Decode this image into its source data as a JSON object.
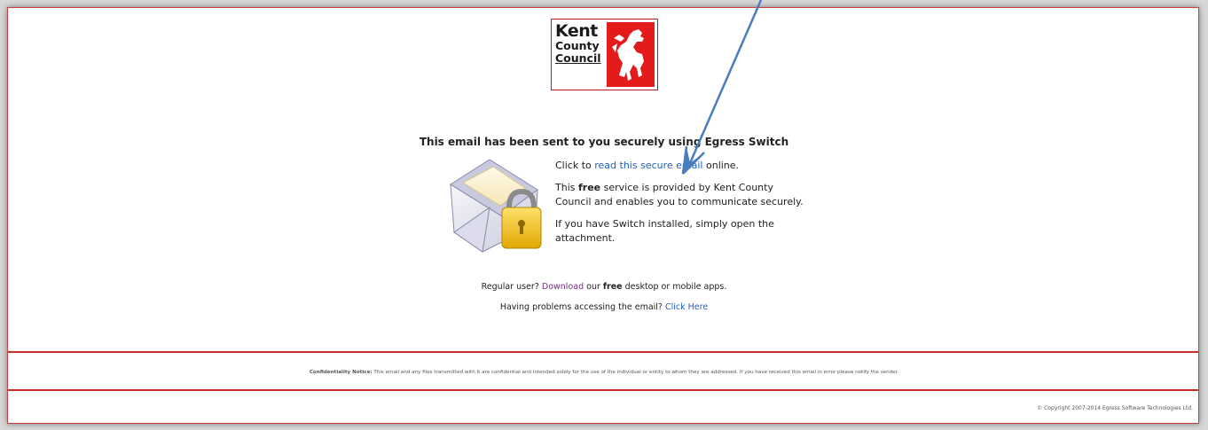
{
  "logo": {
    "line1": "Kent",
    "line2": "County",
    "line3": "Council"
  },
  "headline": "This email has been sent to you securely using Egress Switch",
  "message": {
    "p1_prefix": "Click to ",
    "p1_link": "read this secure email",
    "p1_suffix": " online.",
    "p2_prefix": "This ",
    "p2_bold": "free",
    "p2_suffix": " service is provided by Kent County Council and enables you to communicate securely.",
    "p3": "If you have Switch installed, simply open the attachment."
  },
  "regular": {
    "prefix": "Regular user? ",
    "link": "Download",
    "middle": " our ",
    "bold": "free",
    "suffix": " desktop or mobile apps."
  },
  "problems": {
    "prefix": "Having problems accessing the email? ",
    "link": "Click Here"
  },
  "notice": {
    "label": "Confidentiality Notice:",
    "text": " This email and any files transmitted with it are confidential and intended solely for the use of the individual or entity to whom they are addressed. If you have received this email in error please notify the sender."
  },
  "copyright": "© Copyright 2007-2014 Egress Software Technologies Ltd.",
  "icons": {
    "envelope": "secure-envelope-padlock-icon",
    "logo_horse": "kent-horse-emblem-icon",
    "arrow": "annotation-arrow-icon"
  },
  "colors": {
    "frame_border": "#c94040",
    "link_blue": "#1f5fbf",
    "link_purple": "#7a2c8a",
    "logo_red": "#e31b1b",
    "arrow_blue": "#4a7cc0"
  }
}
